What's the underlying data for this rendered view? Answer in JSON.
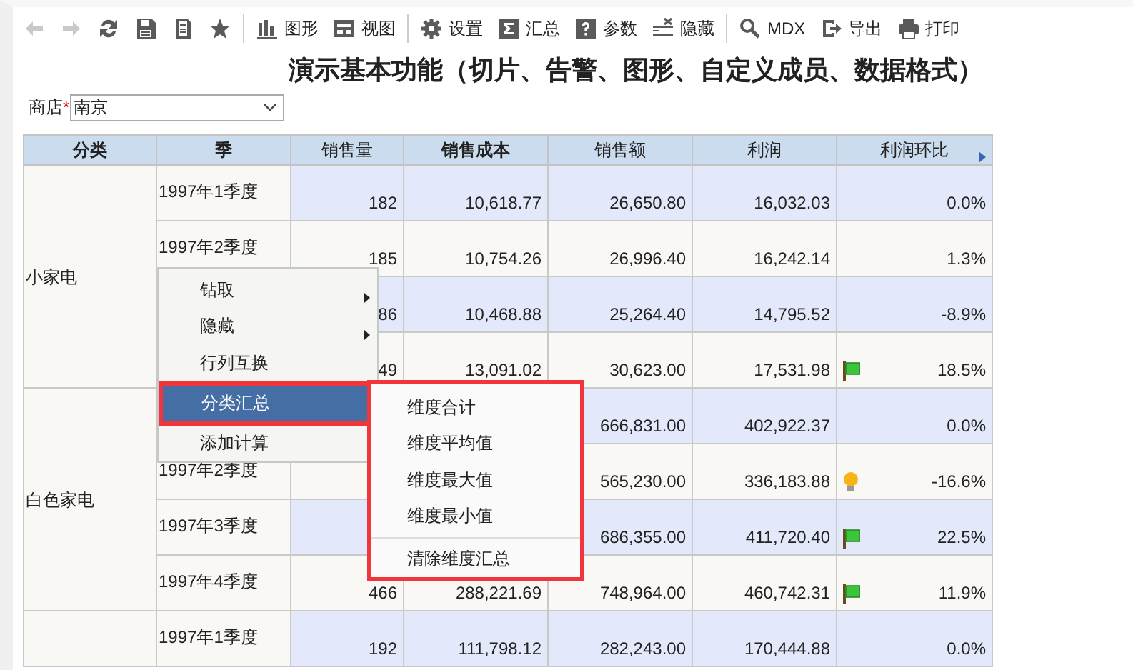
{
  "toolbar": [
    {
      "kind": "back",
      "disabled": true
    },
    {
      "kind": "forward",
      "disabled": true
    },
    {
      "kind": "refresh",
      "disabled": false
    },
    {
      "kind": "save",
      "disabled": false
    },
    {
      "kind": "save-as",
      "disabled": false
    },
    {
      "kind": "favorite",
      "disabled": false
    },
    {
      "kind": "separator"
    },
    {
      "kind": "chart",
      "label": "图形",
      "disabled": false
    },
    {
      "kind": "view",
      "label": "视图",
      "disabled": false
    },
    {
      "kind": "separator"
    },
    {
      "kind": "settings",
      "label": "设置",
      "disabled": false
    },
    {
      "kind": "sum",
      "label": "汇总",
      "disabled": false
    },
    {
      "kind": "help",
      "label": "参数",
      "disabled": false
    },
    {
      "kind": "hide",
      "label": "隐藏",
      "disabled": false
    },
    {
      "kind": "separator"
    },
    {
      "kind": "search",
      "label": "MDX",
      "disabled": false
    },
    {
      "kind": "export",
      "label": "导出",
      "disabled": false
    },
    {
      "kind": "print",
      "label": "打印",
      "disabled": false
    }
  ],
  "title": "演示基本功能（切片、告警、图形、自定义成员、数据格式）",
  "filter": {
    "label": "商店",
    "required_mark": "*",
    "value": "南京"
  },
  "table": {
    "columns": [
      {
        "label": "分类",
        "bold": true
      },
      {
        "label": "季",
        "bold": true
      },
      {
        "label": "销售量",
        "bold": false
      },
      {
        "label": "销售成本",
        "bold": true
      },
      {
        "label": "销售额",
        "bold": false
      },
      {
        "label": "利润",
        "bold": false
      },
      {
        "label": "利润环比",
        "bold": false
      }
    ],
    "groups": [
      {
        "category": "小家电",
        "rows": [
          {
            "quarter": "1997年1季度",
            "quantity": "182",
            "cost": "10,618.77",
            "sales": "26,650.80",
            "profit": "16,032.03",
            "ratio": "0.0%",
            "kind": "plain"
          },
          {
            "quarter": "1997年2季度",
            "quantity": "185",
            "cost": "10,754.26",
            "sales": "26,996.40",
            "profit": "16,242.14",
            "ratio": "1.3%",
            "kind": "plain"
          },
          {
            "quantity": "86",
            "cost": "10,468.88",
            "sales": "25,264.40",
            "profit": "14,795.52",
            "ratio": "-8.9%",
            "kind": "plain"
          },
          {
            "quantity": "49",
            "cost": "13,091.02",
            "sales": "30,623.00",
            "profit": "17,531.98",
            "ratio": "18.5%",
            "kind": "flagged"
          }
        ]
      },
      {
        "category": "白色家电",
        "rows": [
          {
            "sales": "666,831.00",
            "profit": "402,922.37",
            "ratio": "0.0%",
            "kind": "plain"
          },
          {
            "quarter": "1997年2季度",
            "sales": "565,230.00",
            "profit": "336,183.88",
            "ratio": "-16.6%",
            "kind": "warning"
          },
          {
            "quarter": "1997年3季度",
            "sales": "686,355.00",
            "profit": "411,720.40",
            "ratio": "22.5%",
            "kind": "flagged"
          },
          {
            "quarter": "1997年4季度",
            "quantity": "466",
            "cost": "288,221.69",
            "sales": "748,964.00",
            "profit": "460,742.31",
            "ratio": "11.9%",
            "kind": "flagged"
          }
        ]
      },
      {
        "rows": [
          {
            "quarter": "1997年1季度",
            "quantity": "192",
            "cost": "111,798.12",
            "sales": "282,243.00",
            "profit": "170,444.88",
            "ratio": "0.0%",
            "kind": "plain"
          }
        ]
      }
    ]
  },
  "context_menu": {
    "items": [
      {
        "label": "钻取",
        "has_submenu": true,
        "selected": false
      },
      {
        "label": "隐藏",
        "has_submenu": true,
        "selected": false
      },
      {
        "label": "行列互换",
        "has_submenu": false,
        "selected": false
      },
      {
        "label": "分类汇总",
        "has_submenu": true,
        "selected": true
      },
      {
        "label": "添加计算",
        "has_submenu": false,
        "selected": false
      }
    ]
  },
  "submenu": {
    "items": [
      {
        "kind": "item",
        "label": "维度合计"
      },
      {
        "kind": "item",
        "label": "维度平均值"
      },
      {
        "kind": "item",
        "label": "维度最大值"
      },
      {
        "kind": "item",
        "label": "维度最小值"
      },
      {
        "kind": "divider"
      },
      {
        "kind": "item",
        "label": "清除维度汇总"
      }
    ]
  }
}
